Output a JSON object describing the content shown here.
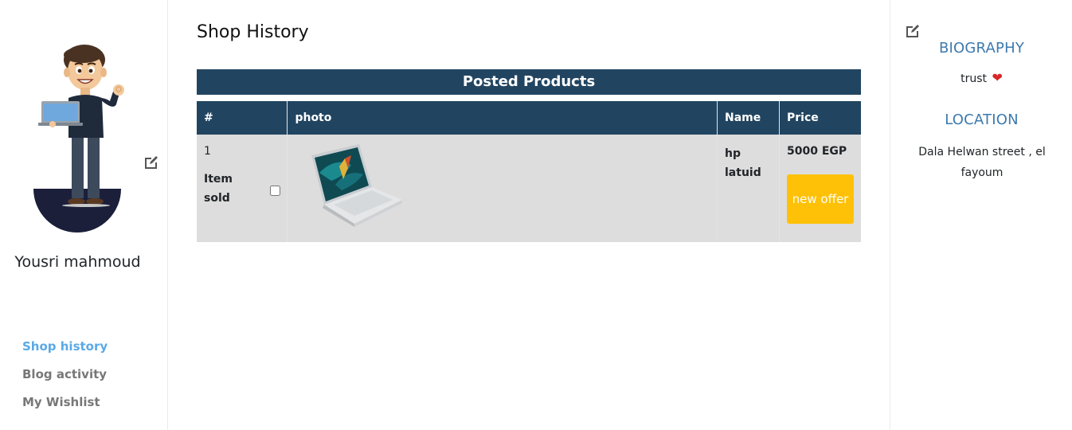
{
  "profile": {
    "name": "Yousri mahmoud"
  },
  "nav": {
    "items": [
      {
        "label": "Shop history",
        "active": true
      },
      {
        "label": "Blog activity",
        "active": false
      },
      {
        "label": "My Wishlist",
        "active": false
      }
    ]
  },
  "main": {
    "title": "Shop History",
    "table": {
      "caption": "Posted Products",
      "headers": [
        "#",
        "photo",
        "Name",
        "Price"
      ],
      "rows": [
        {
          "index": "1",
          "status": "Item sold",
          "sold_checked": false,
          "photo_alt": "laptop",
          "name": "hp latuid",
          "price": "5000 EGP",
          "action_label": "new offer"
        }
      ]
    }
  },
  "biography": {
    "heading": "BIOGRAPHY",
    "text": "trust",
    "emoji": "❤"
  },
  "location": {
    "heading": "LOCATION",
    "text": "Dala Helwan street , el fayoum"
  },
  "colors": {
    "table_header": "#214561",
    "row_bg": "#dddddd",
    "offer_button": "#ffc107",
    "nav_active": "#5aa9e6",
    "section_heading": "#3d7aad"
  }
}
